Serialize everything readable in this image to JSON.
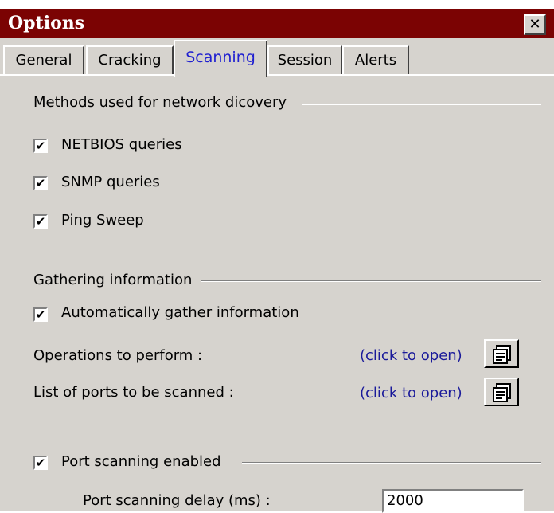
{
  "window": {
    "title": "Options",
    "close_glyph": "✕"
  },
  "tabs": [
    {
      "label": "General"
    },
    {
      "label": "Cracking"
    },
    {
      "label": "Scanning",
      "active": true
    },
    {
      "label": "Session"
    },
    {
      "label": "Alerts"
    }
  ],
  "discovery": {
    "heading": "Methods used for network dicovery",
    "items": [
      {
        "label": "NETBIOS queries",
        "checked": true
      },
      {
        "label": "SNMP queries",
        "checked": true
      },
      {
        "label": "Ping Sweep",
        "checked": true
      }
    ]
  },
  "gathering": {
    "heading": "Gathering information",
    "auto_label": "Automatically gather information",
    "auto_checked": true,
    "operations_label": "Operations to perform  :",
    "operations_link": "(click to open)",
    "ports_label": "List of ports to be scanned :",
    "ports_link": "(click to open)"
  },
  "port_scanning": {
    "enabled_label": "Port scanning enabled",
    "enabled_checked": true,
    "delay_label": "Port scanning delay  (ms) :",
    "delay_value": "2000"
  },
  "check_glyph": "✔",
  "icons": {
    "open": "properties-sheet-icon",
    "close": "close-icon",
    "check": "checkmark-icon"
  }
}
